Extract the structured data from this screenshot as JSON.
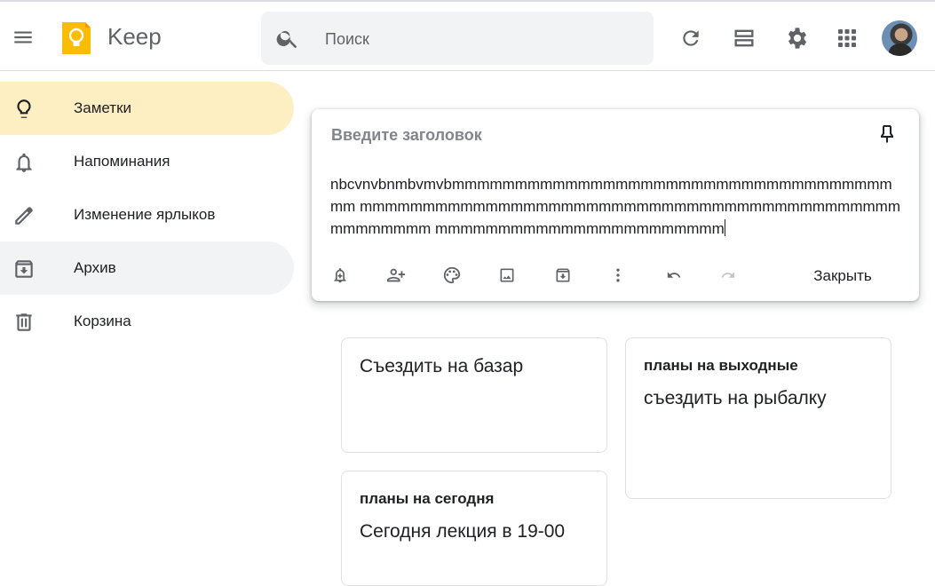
{
  "app": {
    "title": "Keep"
  },
  "search": {
    "placeholder": "Поиск",
    "value": ""
  },
  "header_icons": [
    "menu-icon",
    "keep-logo",
    "search-icon",
    "refresh-icon",
    "list-view-icon",
    "settings-icon",
    "apps-icon",
    "avatar"
  ],
  "sidebar": {
    "items": [
      {
        "label": "Заметки",
        "icon": "lightbulb-icon",
        "active": true
      },
      {
        "label": "Напоминания",
        "icon": "bell-icon"
      },
      {
        "label": "Изменение ярлыков",
        "icon": "pencil-icon"
      },
      {
        "label": "Архив",
        "icon": "archive-icon"
      },
      {
        "label": "Корзина",
        "icon": "trash-icon"
      }
    ]
  },
  "editor": {
    "title_placeholder": "Введите заголовок",
    "body_lines": [
      "nbcvnvbnmbvmvbmmmmmmmmmmmmmmmmmmmmmmmmmmmmmmmmmmmmm",
      "mmmmmmmmmmmmmmmmmmmmmmmmmmmmmmmmmmmmmmmmmmmmmmmmmmm",
      "mmmmmmmmmmmmmmmmmmmmmmm"
    ],
    "close_label": "Закрыть",
    "tools": [
      "remind-me-icon",
      "collaborator-icon",
      "palette-icon",
      "image-icon",
      "archive-icon",
      "more-icon",
      "undo-icon",
      "redo-icon"
    ]
  },
  "notes": [
    {
      "title": "",
      "body": "Съездить на базар"
    },
    {
      "title": "планы на выходные",
      "body": "съездить на рыбалку"
    },
    {
      "title": "планы на сегодня",
      "body": "Сегодня лекция в 19-00"
    }
  ],
  "colors": {
    "active_nav": "#feefc3",
    "logo": "#fbbc04",
    "hover_nav": "#f1f3f4"
  }
}
